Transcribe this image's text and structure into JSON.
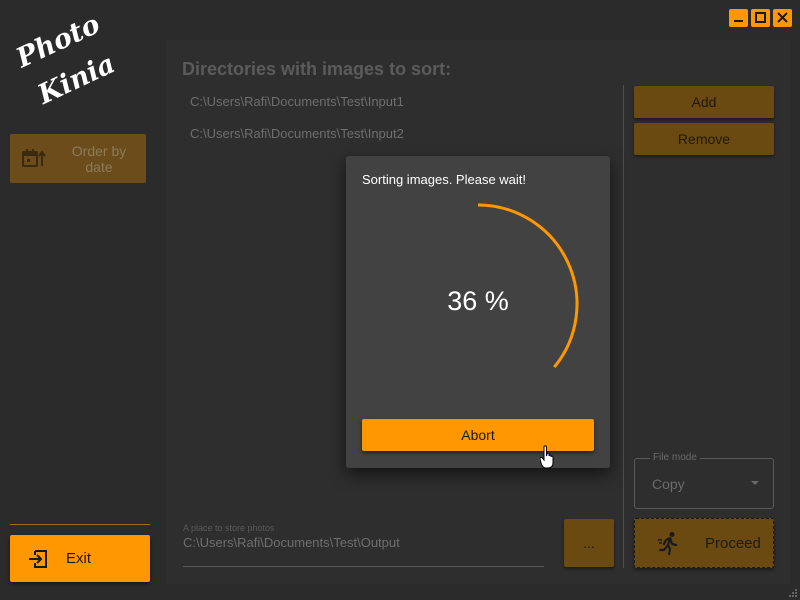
{
  "app": {
    "logo_line1": "Photo",
    "logo_line2": "Kinia",
    "accent_color": "#ff9800"
  },
  "window_controls": [
    {
      "name": "minimize-icon"
    },
    {
      "name": "maximize-icon"
    },
    {
      "name": "close-icon"
    }
  ],
  "sidebar": {
    "order_by_date_label": "Order by date",
    "order_by_date_icon": "calendar-sort-icon",
    "exit_label": "Exit",
    "exit_icon": "exit-icon"
  },
  "main": {
    "title": "Directories with images to sort:",
    "directories": [
      "C:\\Users\\Rafi\\Documents\\Test\\Input1",
      "C:\\Users\\Rafi\\Documents\\Test\\Input2"
    ],
    "add_label": "Add",
    "remove_label": "Remove",
    "file_mode": {
      "label": "File mode",
      "value": "Copy"
    },
    "output": {
      "label": "A place to store photos",
      "value": "C:\\Users\\Rafi\\Documents\\Test\\Output"
    },
    "browse_label": "...",
    "proceed_label": "Proceed",
    "proceed_icon": "running-person-icon"
  },
  "dialog": {
    "message": "Sorting images. Please wait!",
    "progress_text": "36 %",
    "progress": 0.36,
    "abort_label": "Abort"
  }
}
